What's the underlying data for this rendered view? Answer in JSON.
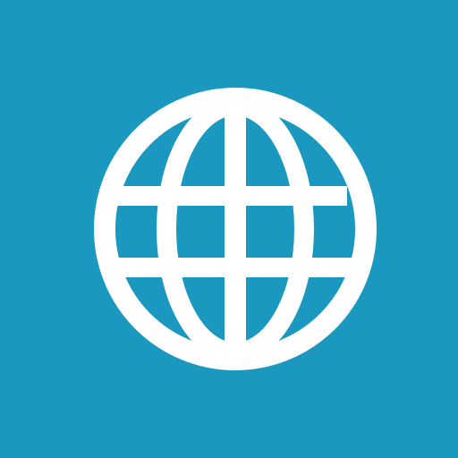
{
  "app_icon": {
    "icon": "globe-icon",
    "background_color": "#1B98BF",
    "icon_color": "#FFFFFF"
  }
}
